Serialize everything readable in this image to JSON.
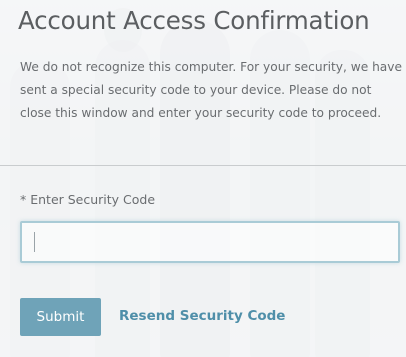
{
  "dialog": {
    "title": "Account Access Confirmation",
    "message": "We do not recognize this computer. For your security, we have sent a special security code to your device. Please do not close this window and enter your security code to proceed.",
    "field_label": "* Enter Security Code",
    "code_value": "",
    "code_placeholder": "",
    "submit_label": "Submit",
    "resend_label": "Resend Security Code"
  },
  "colors": {
    "title": "#5b5e61",
    "text": "#6a6d70",
    "input_border": "#a9cbd6",
    "submit_bg": "#6fa3b8",
    "link": "#4f8fa9"
  }
}
